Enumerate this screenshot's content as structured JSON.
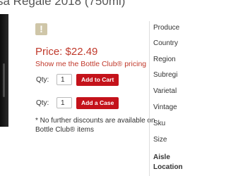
{
  "product": {
    "title": "sa Regale 2018 (750ml)",
    "alert_icon_glyph": "!",
    "price": "Price: $22.49",
    "club_link": "Show me the Bottle Club® pricing",
    "note": "* No further discounts are available on Bottle Club® items"
  },
  "purchase": {
    "row1": {
      "qty_label": "Qty:",
      "qty_value": "1",
      "button": "Add to Cart"
    },
    "row2": {
      "qty_label": "Qty:",
      "qty_value": "1",
      "button": "Add a Case"
    }
  },
  "attributes": [
    "Produce",
    "Country",
    "Region",
    "Subregi",
    "Varietal",
    "Vintage",
    "Sku",
    "Size",
    "Aisle",
    "Location"
  ],
  "colors": {
    "accent_red": "#c4121a",
    "price_red": "#c0392b",
    "badge_bg": "#cfc6a8"
  },
  "icons": [
    "alert-icon"
  ]
}
